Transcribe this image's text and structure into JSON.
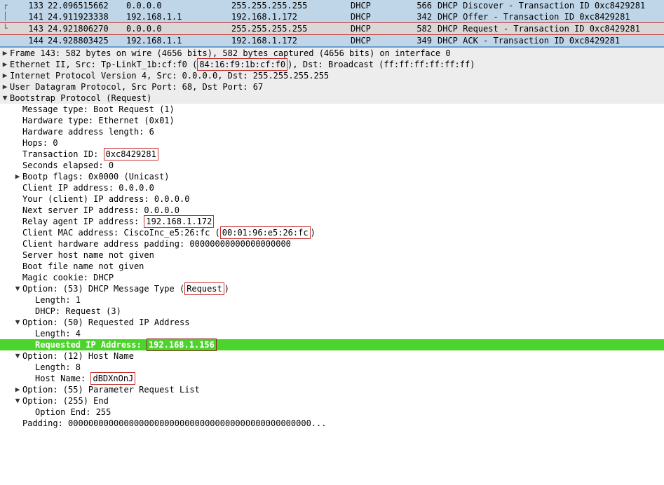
{
  "packets": [
    {
      "num": "133",
      "time": "22.096515662",
      "src": "0.0.0.0",
      "dst": "255.255.255.255",
      "proto": "DHCP",
      "len": "566",
      "info": "DHCP Discover",
      "txid": "0xc8429281",
      "selected": false
    },
    {
      "num": "141",
      "time": "24.911923338",
      "src": "192.168.1.1",
      "dst": "192.168.1.172",
      "proto": "DHCP",
      "len": "342",
      "info": "DHCP Offer",
      "txid": "0xc8429281",
      "selected": false
    },
    {
      "num": "143",
      "time": "24.921806270",
      "src": "0.0.0.0",
      "dst": "255.255.255.255",
      "proto": "DHCP",
      "len": "582",
      "info": "DHCP Request",
      "txid": "0xc8429281",
      "selected": true
    },
    {
      "num": "144",
      "time": "24.928803425",
      "src": "192.168.1.1",
      "dst": "192.168.1.172",
      "proto": "DHCP",
      "len": "349",
      "info": "DHCP ACK",
      "txid": "0xc8429281",
      "selected": false
    }
  ],
  "frame_summary": "Frame 143: 582 bytes on wire (4656 bits), 582 bytes captured (4656 bits) on interface 0",
  "eth": {
    "pre": "Ethernet II, Src: Tp-LinkT_1b:cf:f0 (",
    "mac": "84:16:f9:1b:cf:f0",
    "post": "), Dst: Broadcast (ff:ff:ff:ff:ff:ff)"
  },
  "ip": "Internet Protocol Version 4, Src: 0.0.0.0, Dst: 255.255.255.255",
  "udp": "User Datagram Protocol, Src Port: 68, Dst Port: 67",
  "bootp_hdr": "Bootstrap Protocol (Request)",
  "msg_type": "Message type: Boot Request (1)",
  "hw_type": "Hardware type: Ethernet (0x01)",
  "hw_len": "Hardware address length: 6",
  "hops": "Hops: 0",
  "txid_label": "Transaction ID: ",
  "txid_val": "0xc8429281",
  "secs": "Seconds elapsed: 0",
  "flags": "Bootp flags: 0x0000 (Unicast)",
  "ciaddr": "Client IP address: 0.0.0.0",
  "yiaddr": "Your (client) IP address: 0.0.0.0",
  "siaddr": "Next server IP address: 0.0.0.0",
  "giaddr_label": "Relay agent IP address: ",
  "giaddr_val": "192.168.1.172",
  "chaddr_pre": "Client MAC address: CiscoInc_e5:26:fc (",
  "chaddr_val": "00:01:96:e5:26:fc",
  "chaddr_post": ")",
  "padding_hw": "Client hardware address padding: 00000000000000000000",
  "sname": "Server host name not given",
  "file": "Boot file name not given",
  "cookie": "Magic cookie: DHCP",
  "opt53": {
    "hdr_pre": "Option: (53) DHCP Message Type (",
    "hdr_val": "Request",
    "hdr_post": ")",
    "len": "Length: 1",
    "val": "DHCP: Request (3)"
  },
  "opt50": {
    "hdr": "Option: (50) Requested IP Address",
    "len": "Length: 4",
    "label": "Requested IP Address: ",
    "val": "192.168.1.156"
  },
  "opt12": {
    "hdr": "Option: (12) Host Name",
    "len": "Length: 8",
    "label": "Host Name: ",
    "val": "dBDXnOnJ"
  },
  "opt55": "Option: (55) Parameter Request List",
  "opt255": {
    "hdr": "Option: (255) End",
    "val": "Option End: 255"
  },
  "padding_end": "Padding: 000000000000000000000000000000000000000000000000..."
}
